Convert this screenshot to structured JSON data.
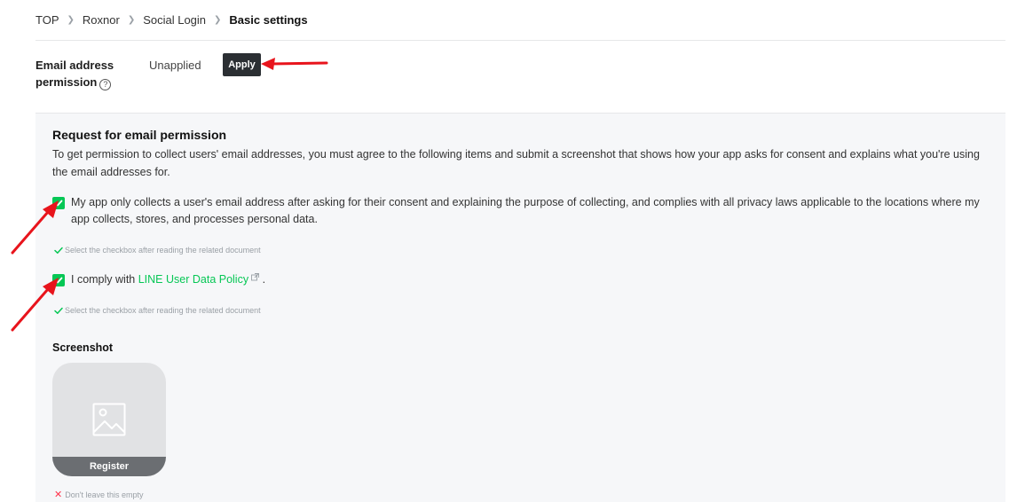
{
  "breadcrumb": {
    "items": [
      "TOP",
      "Roxnor",
      "Social Login"
    ],
    "current": "Basic settings"
  },
  "email_permission": {
    "label_line1": "Email address",
    "label_line2": "permission",
    "help_icon": "?",
    "status": "Unapplied",
    "apply_label": "Apply"
  },
  "request": {
    "title": "Request for email permission",
    "description": "To get permission to collect users' email addresses, you must agree to the following items and submit a screenshot that shows how your app asks for consent and explains what you're using the email addresses for.",
    "items": [
      {
        "checked": true,
        "text": "My app only collects a user's email address after asking for their consent and explaining the purpose of collecting, and complies with all privacy laws applicable to the locations where my app collects, stores, and processes personal data.",
        "hint": "Select the checkbox after reading the related document"
      },
      {
        "checked": true,
        "text_before": "I comply with",
        "link": "LINE User Data Policy",
        "text_after": ".",
        "hint": "Select the checkbox after reading the related document"
      }
    ],
    "screenshot_label": "Screenshot",
    "register_label": "Register",
    "error_text": "Don't leave this empty"
  },
  "colors": {
    "accent_green": "#06c755",
    "annotation_red": "#e8141c",
    "button_dark": "#2b2f33",
    "error_red": "#ff334b"
  },
  "icons": {
    "help": "question-circle-icon",
    "checkbox": "check-icon",
    "external_link": "external-link-icon",
    "image_placeholder": "image-icon",
    "hint_check": "check-icon",
    "error_x": "x-icon"
  }
}
